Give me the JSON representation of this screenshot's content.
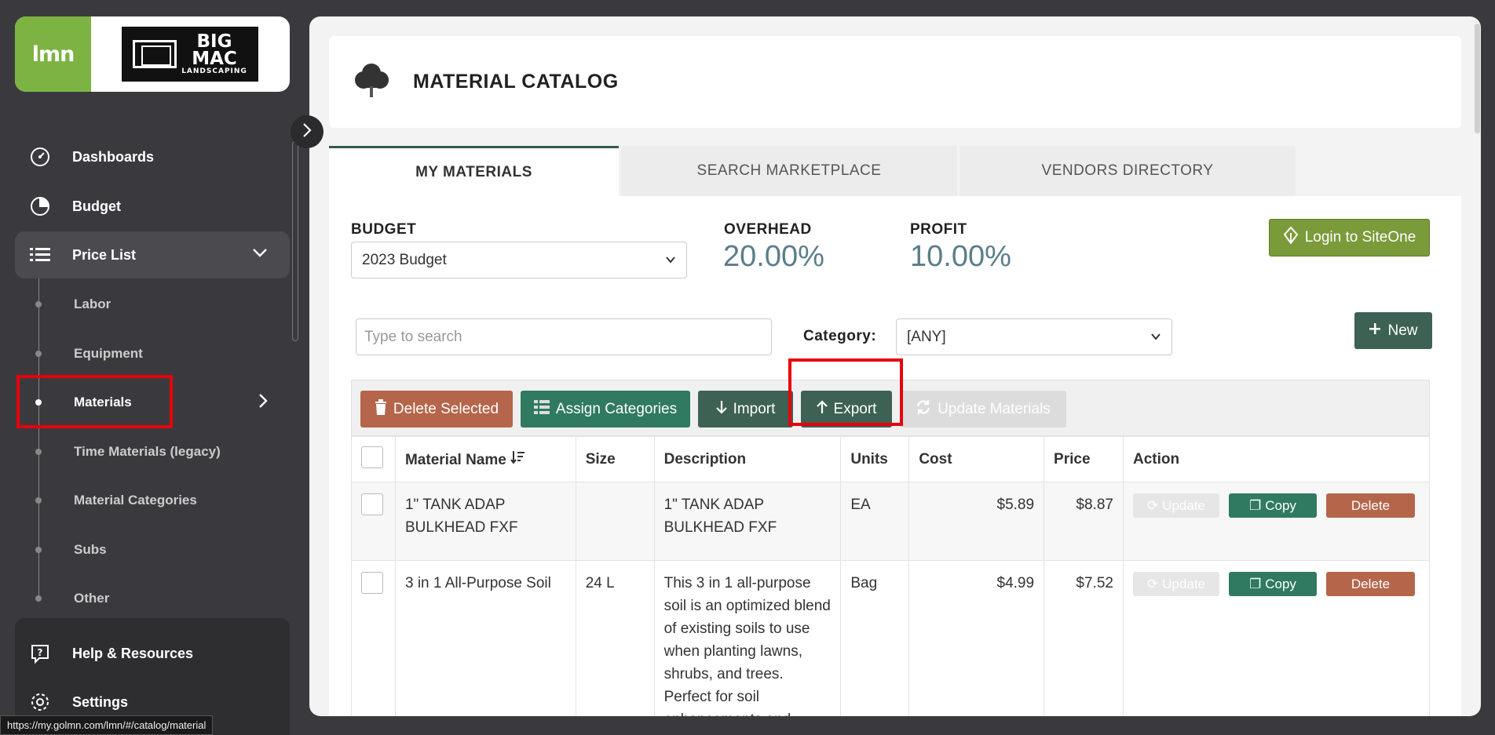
{
  "sidebar": {
    "logo_lmn": "lmn",
    "logo_big": "BIG",
    "logo_mac": "MAC",
    "logo_landscaping": "LANDSCAPING",
    "nav": [
      {
        "label": "Dashboards"
      },
      {
        "label": "Budget"
      },
      {
        "label": "Price List"
      }
    ],
    "sub_items": [
      {
        "label": "Labor"
      },
      {
        "label": "Equipment"
      },
      {
        "label": "Materials"
      },
      {
        "label": "Time Materials (legacy)"
      },
      {
        "label": "Material Categories"
      },
      {
        "label": "Subs"
      },
      {
        "label": "Other"
      }
    ],
    "bottom": [
      {
        "label": "Help & Resources"
      },
      {
        "label": "Settings"
      }
    ]
  },
  "status_url": "https://my.golmn.com/lmn/#/catalog/material",
  "header": {
    "title": "MATERIAL CATALOG"
  },
  "tabs": [
    {
      "label": "MY MATERIALS"
    },
    {
      "label": "SEARCH MARKETPLACE"
    },
    {
      "label": "VENDORS DIRECTORY"
    }
  ],
  "budget": {
    "label": "BUDGET",
    "value": "2023 Budget"
  },
  "overhead": {
    "label": "OVERHEAD",
    "value": "20.00%"
  },
  "profit": {
    "label": "PROFIT",
    "value": "10.00%"
  },
  "login_button": "Login to SiteOne",
  "search": {
    "placeholder": "Type to search"
  },
  "category": {
    "label": "Category:",
    "value": "[ANY]"
  },
  "new_button": "New",
  "toolbar": {
    "delete_selected": "Delete Selected",
    "assign_categories": "Assign Categories",
    "import": "Import",
    "export": "Export",
    "update_materials": "Update Materials"
  },
  "table": {
    "columns": [
      "Material Name",
      "Size",
      "Description",
      "Units",
      "Cost",
      "Price",
      "Action"
    ],
    "rows": [
      {
        "name": "1\" TANK ADAP BULKHEAD FXF",
        "size": "",
        "description": "1\" TANK ADAP BULKHEAD FXF",
        "units": "EA",
        "cost": "$5.89",
        "price": "$8.87"
      },
      {
        "name": "3 in 1 All-Purpose Soil",
        "size": "24 L",
        "description": "This 3 in 1 all-purpose soil is an optimized blend of existing soils to use when planting lawns, shrubs, and trees. Perfect for soil enhancements and",
        "units": "Bag",
        "cost": "$4.99",
        "price": "$7.52"
      }
    ],
    "action_update": "Update",
    "action_copy": "Copy",
    "action_delete": "Delete"
  }
}
